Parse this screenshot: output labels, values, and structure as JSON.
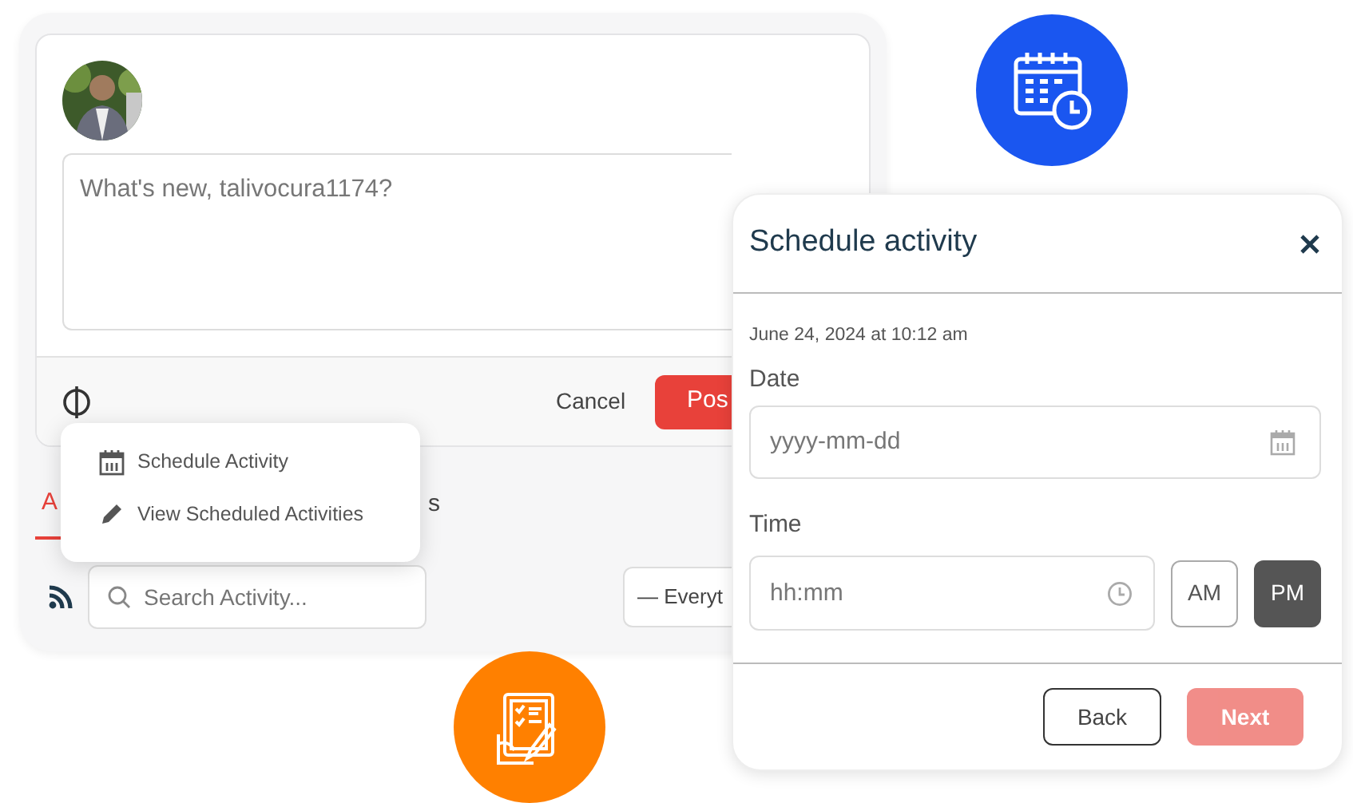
{
  "composer": {
    "placeholder": "What's new, talivocura1174?",
    "cancel": "Cancel",
    "post": "Pos"
  },
  "menu": {
    "items": [
      {
        "label": "Schedule Activity",
        "kind": "calendar"
      },
      {
        "label": "View Scheduled Activities",
        "kind": "pencil"
      }
    ]
  },
  "tabs": [
    {
      "label": "A",
      "selected": true
    },
    {
      "label": "s",
      "selected": false
    }
  ],
  "search": {
    "placeholder": "Search Activity..."
  },
  "filter": {
    "value": "— Everyt"
  },
  "modal": {
    "title": "Schedule activity",
    "timestamp": "June 24, 2024 at 10:12 am",
    "date_label": "Date",
    "date_placeholder": "yyyy-mm-dd",
    "time_label": "Time",
    "time_placeholder": "hh:mm",
    "meridiem": [
      {
        "label": "AM",
        "selected": false
      },
      {
        "label": "PM",
        "selected": true
      }
    ],
    "back": "Back",
    "next": "Next",
    "next_disabled": true
  }
}
